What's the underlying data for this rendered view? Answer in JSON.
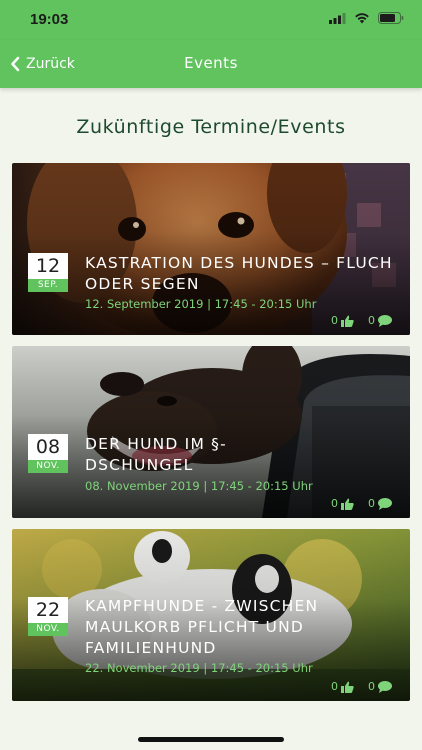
{
  "status": {
    "time": "19:03"
  },
  "nav": {
    "back_label": "Zurück",
    "title": "Events"
  },
  "heading": "Zukünftige Termine/Events",
  "events": [
    {
      "day": "12",
      "month": "SEP.",
      "title": "KASTRATION DES HUNDES – FLUCH ODER SEGEN",
      "meta": "12. September 2019 | 17:45 - 20:15 Uhr",
      "likes": "0",
      "comments": "0"
    },
    {
      "day": "08",
      "month": "NOV.",
      "title": "DER HUND IM §-DSCHUNGEL",
      "meta": "08. November 2019 | 17:45 - 20:15 Uhr",
      "likes": "0",
      "comments": "0"
    },
    {
      "day": "22",
      "month": "NOV.",
      "title": "KAMPFHUNDE - ZWISCHEN MAULKORB PFLICHT UND FAMILIENHUND",
      "meta": "22. November 2019 | 17:45 - 20:15 Uhr",
      "likes": "0",
      "comments": "0"
    }
  ],
  "colors": {
    "accent": "#60c35e",
    "heading": "#1e4a2e",
    "meta": "#7fd47b"
  }
}
